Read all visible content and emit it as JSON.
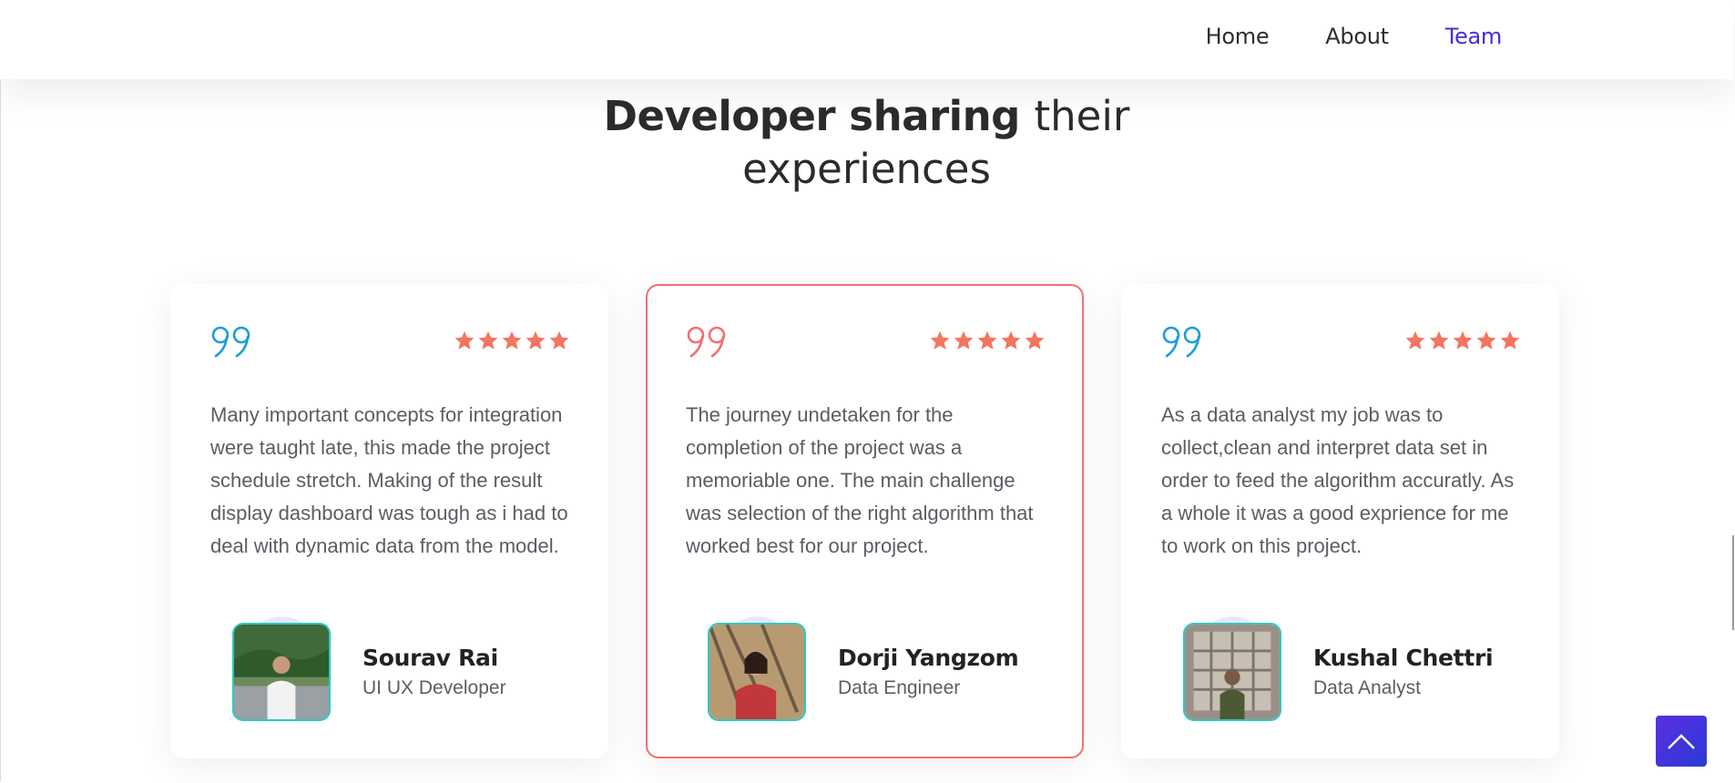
{
  "nav": {
    "items": [
      {
        "label": "Home",
        "active": false
      },
      {
        "label": "About",
        "active": false
      },
      {
        "label": "Team",
        "active": true
      }
    ]
  },
  "heading": {
    "bold": "Developer sharing",
    "light_line1": "their",
    "light_line2": "experiences"
  },
  "testimonials": [
    {
      "quote_icon": "double-quote-icon",
      "quote_color": "#1a9fd6",
      "rating": 5,
      "text": "Many important concepts for integration were taught late, this made the project schedule stretch. Making of the result display dashboard was tough as i had to deal with dynamic data from the model.",
      "name": "Sourav Rai",
      "role": "UI UX Developer",
      "featured": false
    },
    {
      "quote_icon": "double-quote-icon",
      "quote_color": "#f26f72",
      "rating": 5,
      "text": "The journey undetaken for the completion of the project was a memoriable one. The main challenge was selection of the right algorithm that worked best for our project.",
      "name": "Dorji Yangzom",
      "role": "Data Engineer",
      "featured": true
    },
    {
      "quote_icon": "double-quote-icon",
      "quote_color": "#1a9fd6",
      "rating": 5,
      "text": "As a data analyst my job was to collect,clean and interpret data set in order to feed the algorithm accuratly. As a whole it was a good exprience for me to work on this project.",
      "name": "Kushal Chettri",
      "role": "Data Analyst",
      "featured": false
    }
  ],
  "colors": {
    "accent": "#4c2ccf",
    "star": "#f4745f",
    "featured_border": "#f26f72",
    "avatar_border": "#29c9c5",
    "scroll_button": "#3b35dc"
  },
  "scroll_top": {
    "icon": "chevron-up-icon"
  }
}
